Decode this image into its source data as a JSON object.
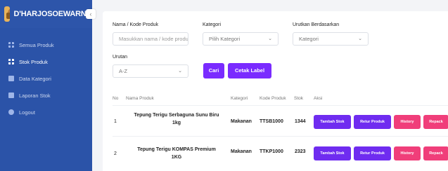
{
  "sidebar": {
    "brand": "D'HARJOSOEWARNO",
    "collapse_icon": "‹",
    "items": [
      {
        "label": "Semua Produk",
        "icon": "grid-icon"
      },
      {
        "label": "Stok Produk",
        "icon": "grid-icon",
        "active": true
      },
      {
        "label": "Data Kategori",
        "icon": "table-icon"
      },
      {
        "label": "Laporan Stok",
        "icon": "chart-icon"
      },
      {
        "label": "Logout",
        "icon": "logout-icon"
      }
    ]
  },
  "filters": {
    "produk_label": "Nama / Kode Produk",
    "produk_placeholder": "Masukkan nama / kode produ",
    "kategori_label": "Kategori",
    "kategori_value": "Pilih Kategori",
    "urutkan_label": "Urutkan Berdasarkan",
    "urutkan_value": "Kategori",
    "urutan_label": "Urutan",
    "urutan_value": "A-Z",
    "cari_label": "Cari",
    "cetak_label": "Cetak Label"
  },
  "table": {
    "headers": [
      "No",
      "Nama Produk",
      "Kategori",
      "Kode Produk",
      "Stok",
      "Aksi"
    ],
    "rows": [
      {
        "no": "1",
        "nama": "Tepung Terigu Serbaguna Sunu Biru 1kg",
        "kategori": "Makanan",
        "kode": "TTSB1000",
        "stok": "1344"
      },
      {
        "no": "2",
        "nama": "Tepung Terigu KOMPAS Premium 1KG",
        "kategori": "Makanan",
        "kode": "TTKP1000",
        "stok": "2323"
      }
    ],
    "actions": {
      "tambah": "Tambah Stok",
      "retur": "Retur Produk",
      "history": "History",
      "repack": "Repack"
    }
  },
  "colors": {
    "sidebar": "#2b53a8",
    "primary": "#7a2bff",
    "danger": "#f03e7a"
  }
}
